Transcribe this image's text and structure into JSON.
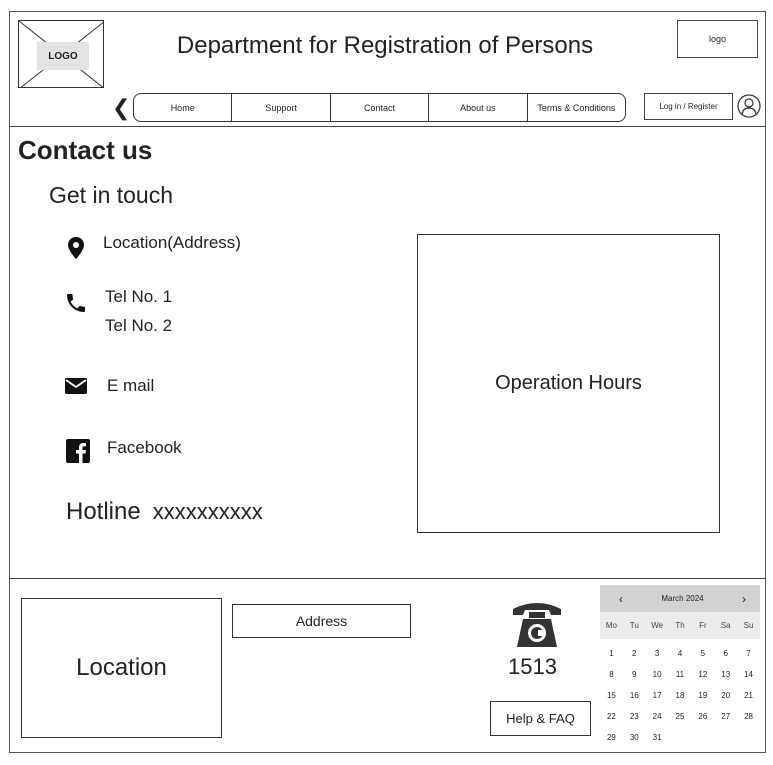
{
  "header": {
    "logo_left": "LOGO",
    "title": "Department for Registration of Persons",
    "logo_right": "logo",
    "login_label": "Log in / Register"
  },
  "nav": {
    "items": [
      {
        "label": "Home"
      },
      {
        "label": "Support"
      },
      {
        "label": "Contact"
      },
      {
        "label": "About us"
      },
      {
        "label": "Terms & Conditions"
      }
    ]
  },
  "content": {
    "page_title": "Contact us",
    "subtitle": "Get in touch",
    "location": "Location(Address)",
    "tel_1": "Tel No. 1",
    "tel_2": "Tel No. 2",
    "email": "E mail",
    "facebook": "Facebook",
    "hotline_label": "Hotline",
    "hotline_value": "xxxxxxxxxx",
    "operation_hours": "Operation Hours"
  },
  "footer": {
    "location": "Location",
    "address": "Address",
    "hotline_number": "1513",
    "help_label": "Help & FAQ"
  },
  "calendar": {
    "month": "March 2024",
    "days": [
      "Mo",
      "Tu",
      "We",
      "Th",
      "Fr",
      "Sa",
      "Su"
    ],
    "dates": [
      "1",
      "2",
      "3",
      "4",
      "5",
      "6",
      "7",
      "8",
      "9",
      "10",
      "11",
      "12",
      "13",
      "14",
      "15",
      "16",
      "17",
      "18",
      "19",
      "20",
      "21",
      "22",
      "23",
      "24",
      "25",
      "26",
      "27",
      "28",
      "29",
      "30",
      "31"
    ]
  }
}
